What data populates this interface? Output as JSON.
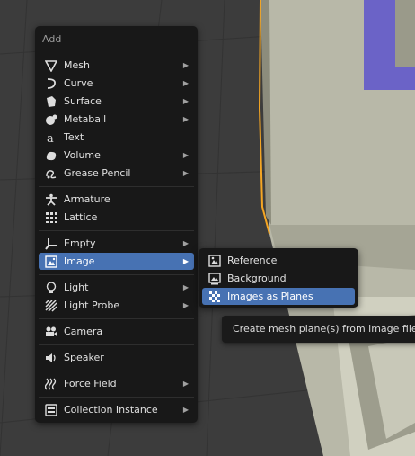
{
  "menu": {
    "title": "Add",
    "items": [
      {
        "label": "Mesh",
        "icon": "mesh-icon",
        "submenu": true
      },
      {
        "label": "Curve",
        "icon": "curve-icon",
        "submenu": true
      },
      {
        "label": "Surface",
        "icon": "surface-icon",
        "submenu": true
      },
      {
        "label": "Metaball",
        "icon": "metaball-icon",
        "submenu": true
      },
      {
        "label": "Text",
        "icon": "text-icon",
        "submenu": false
      },
      {
        "label": "Volume",
        "icon": "volume-icon",
        "submenu": true
      },
      {
        "label": "Grease Pencil",
        "icon": "grease-pencil-icon",
        "submenu": true
      },
      {
        "label": "Armature",
        "icon": "armature-icon",
        "submenu": false
      },
      {
        "label": "Lattice",
        "icon": "lattice-icon",
        "submenu": false
      },
      {
        "label": "Empty",
        "icon": "empty-icon",
        "submenu": true
      },
      {
        "label": "Image",
        "icon": "image-icon",
        "submenu": true,
        "active": true
      },
      {
        "label": "Light",
        "icon": "light-icon",
        "submenu": true
      },
      {
        "label": "Light Probe",
        "icon": "light-probe-icon",
        "submenu": true
      },
      {
        "label": "Camera",
        "icon": "camera-icon",
        "submenu": false
      },
      {
        "label": "Speaker",
        "icon": "speaker-icon",
        "submenu": false
      },
      {
        "label": "Force Field",
        "icon": "force-field-icon",
        "submenu": true
      },
      {
        "label": "Collection Instance",
        "icon": "collection-instance-icon",
        "submenu": true
      }
    ]
  },
  "image_submenu": {
    "items": [
      {
        "label": "Reference",
        "icon": "reference-image-icon"
      },
      {
        "label": "Background",
        "icon": "background-image-icon"
      },
      {
        "label": "Images as Planes",
        "icon": "images-as-planes-icon",
        "active": true
      }
    ]
  },
  "tooltip": {
    "text": "Create mesh plane(s) from image files wi"
  },
  "colors": {
    "menu_bg": "#181818",
    "highlight": "#4772b3",
    "outline": "#f5a623",
    "selection_purple": "#6b63c7"
  }
}
